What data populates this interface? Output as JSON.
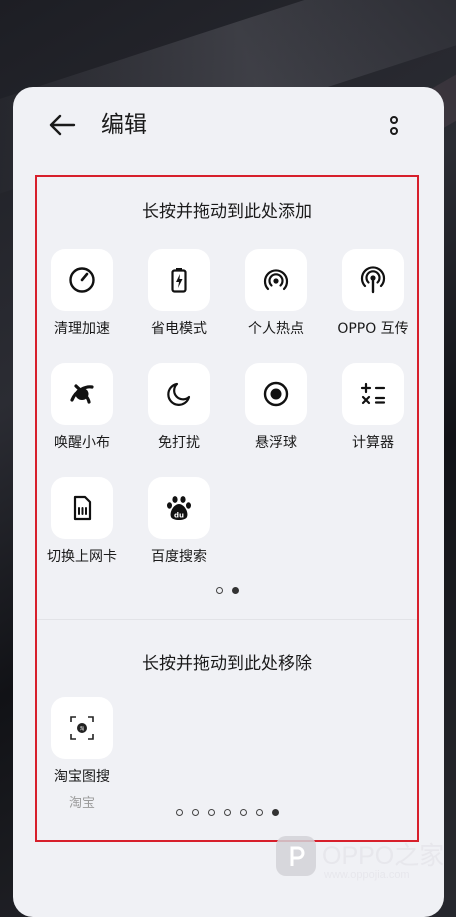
{
  "header": {
    "title": "编辑"
  },
  "add_section": {
    "title": "长按并拖动到此处添加",
    "tiles": [
      {
        "label": "清理加速",
        "icon": "speedometer-icon"
      },
      {
        "label": "省电模式",
        "icon": "battery-saver-icon"
      },
      {
        "label": "个人热点",
        "icon": "hotspot-icon"
      },
      {
        "label": "OPPO 互传",
        "icon": "oppo-share-icon"
      },
      {
        "label": "唤醒小布",
        "icon": "breeno-icon"
      },
      {
        "label": "免打扰",
        "icon": "moon-icon"
      },
      {
        "label": "悬浮球",
        "icon": "floating-ball-icon"
      },
      {
        "label": "计算器",
        "icon": "calculator-icon"
      },
      {
        "label": "切换上网卡",
        "icon": "sim-card-icon"
      },
      {
        "label": "百度搜索",
        "icon": "baidu-paw-icon"
      }
    ],
    "pager": {
      "count": 2,
      "active_index": 1
    }
  },
  "remove_section": {
    "title": "长按并拖动到此处移除",
    "tiles": [
      {
        "label": "淘宝图搜",
        "sub_label": "淘宝",
        "icon": "taobao-image-search-icon"
      }
    ],
    "pager": {
      "count": 7,
      "active_index": 6
    }
  },
  "watermark": {
    "text": "OPPO之家",
    "url": "www.oppojia.com"
  }
}
